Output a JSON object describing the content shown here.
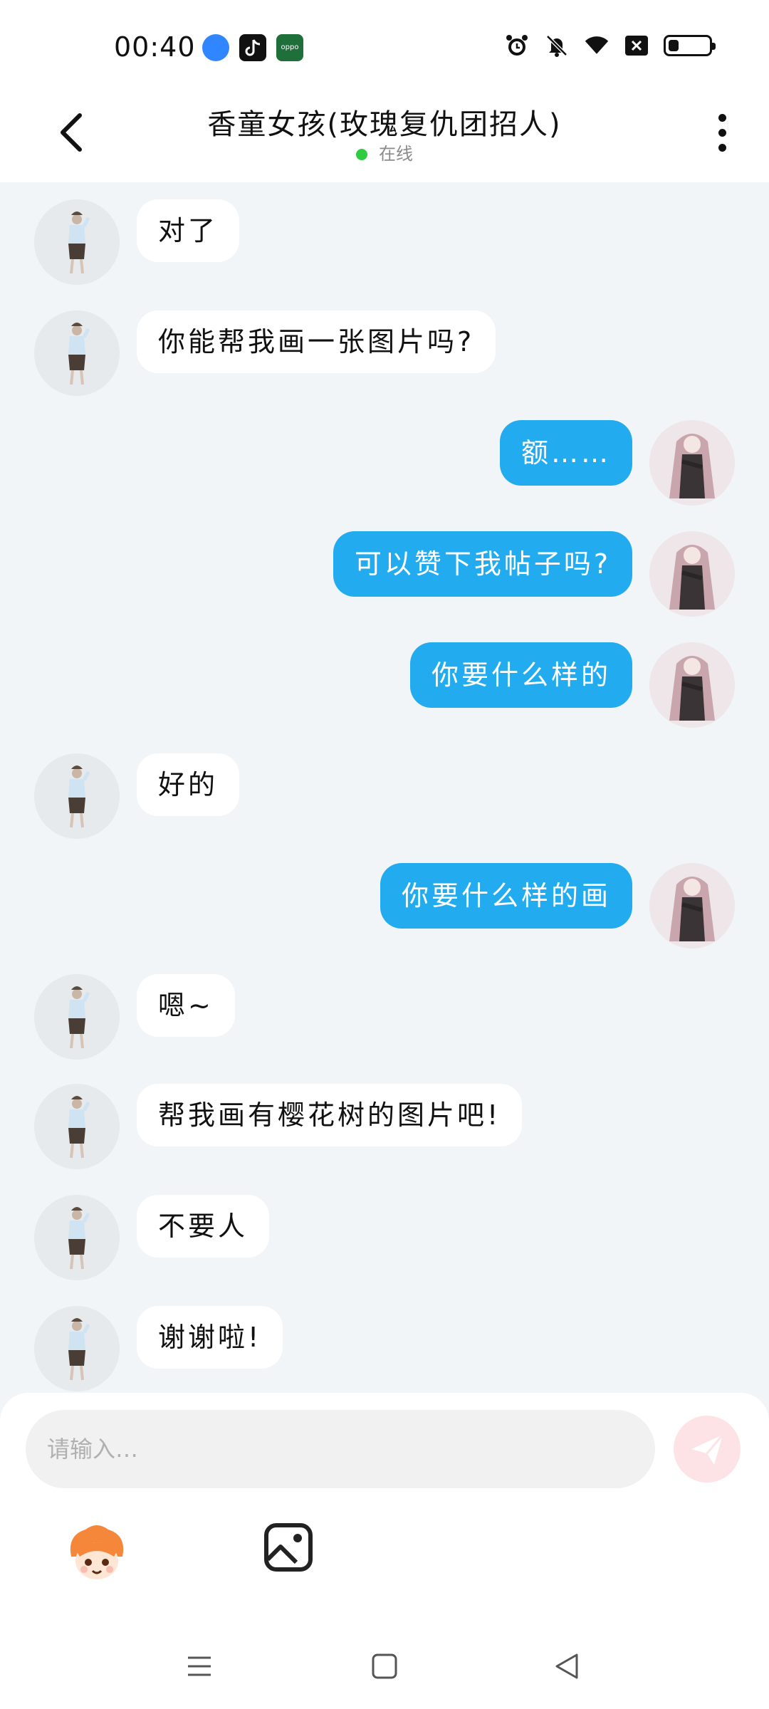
{
  "status_bar": {
    "time": "00:40",
    "apps": [
      "browser-icon",
      "tiktok-icon",
      "oppo-icon"
    ],
    "oppo_label": "oppo",
    "battery_level": 0.25
  },
  "header": {
    "title": "香童女孩(玫瑰复仇团招人)",
    "status": "在线",
    "status_color": "#2ecc40"
  },
  "messages": [
    {
      "side": "left",
      "text": "对了"
    },
    {
      "side": "left",
      "text": "你能帮我画一张图片吗?"
    },
    {
      "side": "right",
      "text": "额……"
    },
    {
      "side": "right",
      "text": "可以赞下我帖子吗?"
    },
    {
      "side": "right",
      "text": "你要什么样的"
    },
    {
      "side": "left",
      "text": "好的"
    },
    {
      "side": "right",
      "text": "你要什么样的画"
    },
    {
      "side": "left",
      "text": "嗯~"
    },
    {
      "side": "left",
      "text": "帮我画有樱花树的图片吧!"
    },
    {
      "side": "left",
      "text": "不要人"
    },
    {
      "side": "left",
      "text": "谢谢啦!"
    }
  ],
  "composer": {
    "placeholder": "请输入…",
    "send_color": "#fde3e5"
  },
  "colors": {
    "accent": "#22acef",
    "background": "#f2f5f8"
  }
}
